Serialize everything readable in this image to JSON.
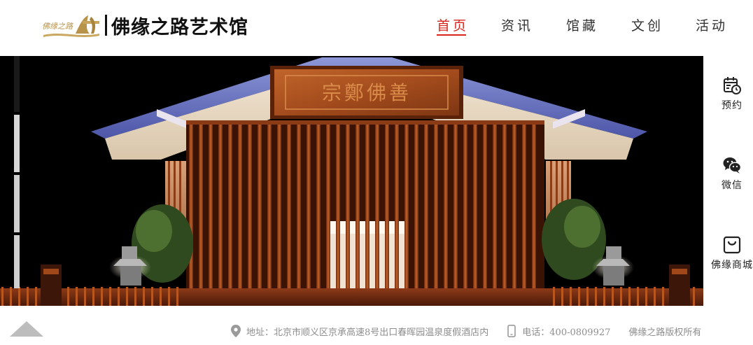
{
  "brand": {
    "logo_script": "佛缘之路",
    "name": "佛缘之路艺术馆",
    "gold": "#b8934a"
  },
  "nav": {
    "items": [
      {
        "label": "首页",
        "active": true
      },
      {
        "label": "资讯",
        "active": false
      },
      {
        "label": "馆藏",
        "active": false
      },
      {
        "label": "文创",
        "active": false
      },
      {
        "label": "活动",
        "active": false
      }
    ],
    "active_color": "#d9261c"
  },
  "hero": {
    "plaque_text": "宗鄭佛善",
    "slider_count": 4,
    "slider_active": 1
  },
  "rail": {
    "items": [
      {
        "label": "预约",
        "icon": "calendar-clock-icon"
      },
      {
        "label": "微信",
        "icon": "wechat-icon"
      },
      {
        "label": "佛缘商城",
        "icon": "shopping-bag-icon"
      }
    ]
  },
  "footer": {
    "address": "地址：北京市顺义区京承高速8号出口春晖园温泉度假酒店内",
    "phone": "电话：400-0809927",
    "copyright": "佛缘之路版权所有",
    "address_icon": "location-pin-icon",
    "phone_icon": "mobile-phone-icon",
    "up_icon": "back-to-top-icon"
  }
}
